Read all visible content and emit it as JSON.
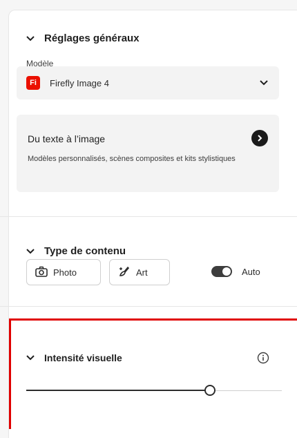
{
  "general": {
    "title": "Réglages généraux",
    "model_label": "Modèle",
    "model_badge": "Fi",
    "model_name": "Firefly Image 4",
    "card_title": "Du texte à l’image",
    "card_desc": "Modèles personnalisés, scènes composites et kits stylistiques"
  },
  "content_type": {
    "title": "Type de contenu",
    "photo_label": "Photo",
    "art_label": "Art",
    "auto_label": "Auto",
    "auto_on": true
  },
  "visual_intensity": {
    "title": "Intensité visuelle",
    "value_fraction": 0.72
  },
  "colors": {
    "highlight": "#e00000",
    "badge": "#eb1000"
  }
}
